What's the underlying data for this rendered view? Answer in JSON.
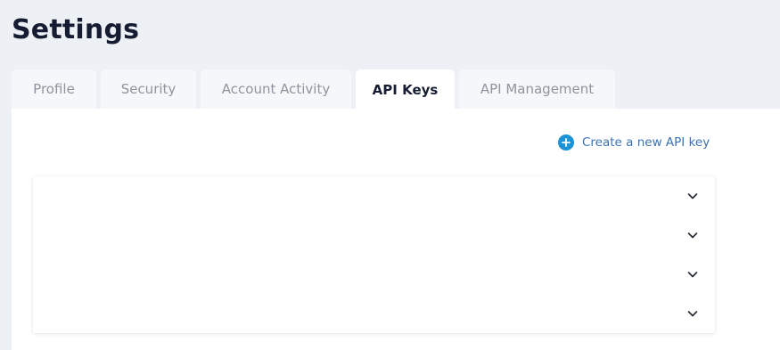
{
  "page": {
    "title": "Settings"
  },
  "tabs": [
    {
      "label": "Profile",
      "active": false
    },
    {
      "label": "Security",
      "active": false
    },
    {
      "label": "Account Activity",
      "active": false
    },
    {
      "label": "API Keys",
      "active": true
    },
    {
      "label": "API Management",
      "active": false
    }
  ],
  "api_keys": {
    "create_label": "Create a new API key",
    "create_icon": "plus-circle-icon",
    "row_icon": "chevron-down-icon",
    "accent_color": "#1a93d8",
    "rows": [
      {
        "expanded": false
      },
      {
        "expanded": false
      },
      {
        "expanded": false
      },
      {
        "expanded": false
      }
    ]
  }
}
